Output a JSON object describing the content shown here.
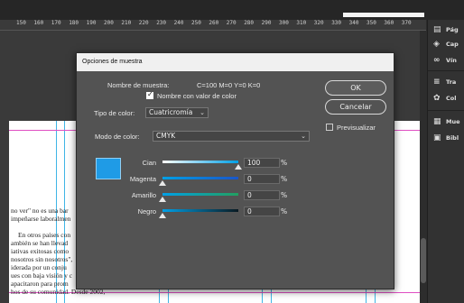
{
  "ruler": {
    "ticks": [
      "150",
      "160",
      "170",
      "180",
      "190",
      "200",
      "210",
      "220",
      "230",
      "240",
      "250",
      "260",
      "270",
      "280",
      "290",
      "300",
      "310",
      "320",
      "330",
      "340",
      "350",
      "360",
      "370"
    ]
  },
  "panel": {
    "items": [
      {
        "label": "Pág",
        "icon": "pages-icon"
      },
      {
        "label": "Cap",
        "icon": "layers-icon"
      },
      {
        "label": "Vín",
        "icon": "links-icon"
      },
      {
        "label": "Tra",
        "icon": "stroke-icon"
      },
      {
        "label": "Col",
        "icon": "color-icon"
      },
      {
        "label": "Mue",
        "icon": "swatches-icon"
      },
      {
        "label": "Bibl",
        "icon": "library-icon"
      }
    ]
  },
  "document": {
    "lines": [
      "no ver\" no es una bar",
      "impeñarse laboralmen",
      "",
      "En otros países con",
      "ambién se han llevad",
      "iativas exitosas como",
      "nosotros sin nosotros\",",
      "iderada por un conju",
      "ues con baja visión y c",
      "apacitaron para prom",
      "hos de su comunidad. Desde 2002,"
    ]
  },
  "dialog": {
    "title": "Opciones de muestra",
    "sample_name_label": "Nombre de muestra:",
    "sample_name_value": "C=100 M=0 Y=0 K=0",
    "name_with_value_label": "Nombre con valor de color",
    "name_with_value_checked": true,
    "color_type_label": "Tipo de color:",
    "color_type_value": "Cuatricromía",
    "color_mode_label": "Modo de color:",
    "color_mode_value": "CMYK",
    "ok_label": "OK",
    "cancel_label": "Cancelar",
    "preview_label": "Previsualizar",
    "preview_checked": false,
    "swatch_color": "#1f9be6",
    "channels": [
      {
        "name": "Cian",
        "value": "100",
        "unit": "%",
        "level": 1.0,
        "gradient": [
          "#ffffff",
          "#00a0e6"
        ]
      },
      {
        "name": "Magenta",
        "value": "0",
        "unit": "%",
        "level": 0.0,
        "gradient": [
          "#00a0e6",
          "#1a56c8"
        ]
      },
      {
        "name": "Amarillo",
        "value": "0",
        "unit": "%",
        "level": 0.0,
        "gradient": [
          "#00a0e6",
          "#22a060"
        ]
      },
      {
        "name": "Negro",
        "value": "0",
        "unit": "%",
        "level": 0.0,
        "gradient": [
          "#00a0e6",
          "#0a1a22"
        ]
      }
    ]
  }
}
